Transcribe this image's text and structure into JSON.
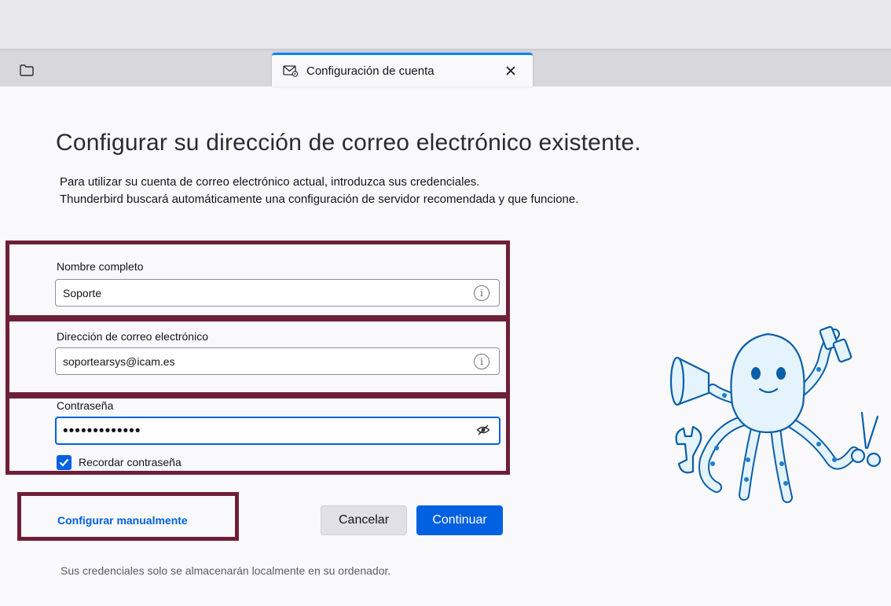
{
  "window": {
    "tab_title": "Configuración de cuenta"
  },
  "icons": {
    "folder": "folder-icon",
    "tab": "mail-settings-icon",
    "close": "close-icon",
    "info": "info-icon",
    "eye": "eye-slash-icon",
    "check": "checkmark-icon"
  },
  "page": {
    "heading": "Configurar su dirección de correo electrónico existente.",
    "intro_line1": "Para utilizar su cuenta de correo electrónico actual, introduzca sus credenciales.",
    "intro_line2": "Thunderbird buscará automáticamente una configuración de servidor recomendada y que funcione."
  },
  "form": {
    "name_label": "Nombre completo",
    "name_value": "Soporte",
    "email_label": "Dirección de correo electrónico",
    "email_value": "soportearsys@icam.es",
    "password_label": "Contraseña",
    "password_masked": "•••••••••••••",
    "remember_label": "Recordar contraseña",
    "remember_checked": true
  },
  "actions": {
    "manual_label": "Configurar manualmente",
    "cancel_label": "Cancelar",
    "continue_label": "Continuar"
  },
  "footer": {
    "note": "Sus credenciales solo se almacenarán localmente en su ordenador."
  },
  "colors": {
    "accent": "#0061e0",
    "highlight_box": "#6e1f38",
    "tab_accent": "#0a84ff"
  }
}
